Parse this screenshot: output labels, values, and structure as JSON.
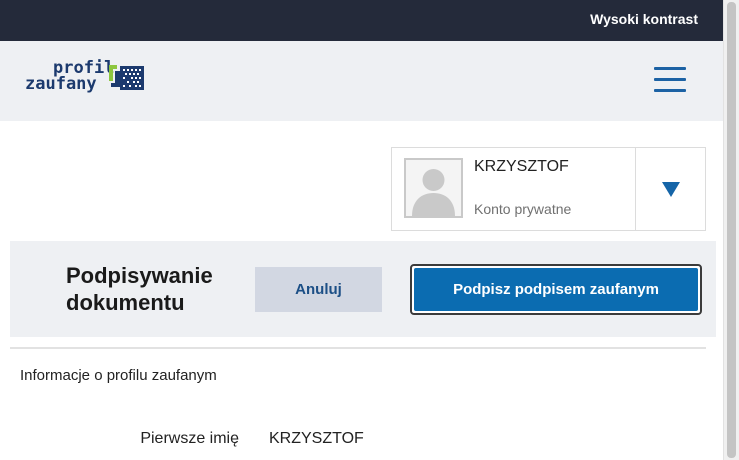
{
  "topbar": {
    "contrast_label": "Wysoki kontrast"
  },
  "header": {
    "logo_line1": "profil",
    "logo_line2": "zaufany",
    "colors": {
      "logo_text": "#1c3a6e",
      "logo_green": "#8dc63f",
      "menu": "#1c62a4"
    }
  },
  "user": {
    "name": "KRZYSZTOF",
    "account_type": "Konto prywatne"
  },
  "action": {
    "title_line1": "Podpisywanie",
    "title_line2": "dokumentu",
    "cancel_label": "Anuluj",
    "sign_label": "Podpisz podpisem zaufanym",
    "colors": {
      "sign": "#0b6cb1",
      "cancel": "#d2d7e2"
    }
  },
  "profile_info": {
    "heading": "Informacje o profilu zaufanym",
    "fields": [
      {
        "label": "Pierwsze imię",
        "value": "KRZYSZTOF"
      }
    ]
  }
}
